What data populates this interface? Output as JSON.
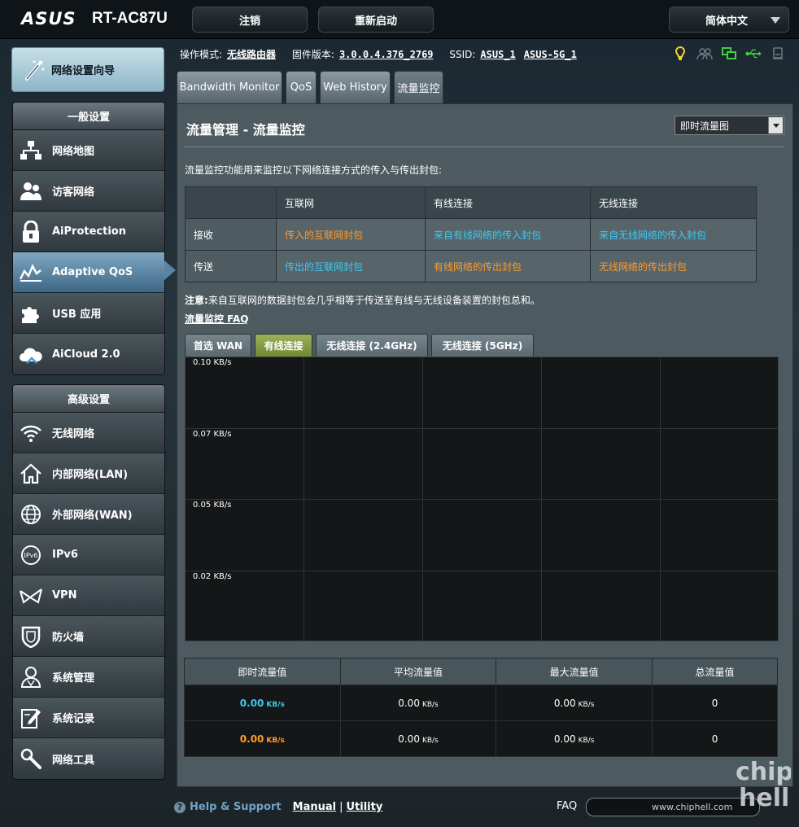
{
  "header": {
    "brand": "ASUS",
    "model": "RT-AC87U",
    "logout_label": "注销",
    "reboot_label": "重新启动",
    "language": "简体中文"
  },
  "sidebar": {
    "wizard_label": "网络设置向导",
    "general_title": "一般设置",
    "general_items": [
      {
        "label": "网络地图",
        "icon": "network-map-icon"
      },
      {
        "label": "访客网络",
        "icon": "guest-network-icon"
      },
      {
        "label": "AiProtection",
        "icon": "lock-icon"
      },
      {
        "label": "Adaptive QoS",
        "icon": "qos-icon",
        "active": true
      },
      {
        "label": "USB 应用",
        "icon": "puzzle-icon"
      },
      {
        "label": "AiCloud 2.0",
        "icon": "cloud-icon"
      }
    ],
    "advanced_title": "高级设置",
    "advanced_items": [
      {
        "label": "无线网络",
        "icon": "wifi-icon"
      },
      {
        "label": "内部网络(LAN)",
        "icon": "home-icon"
      },
      {
        "label": "外部网络(WAN)",
        "icon": "globe-icon"
      },
      {
        "label": "IPv6",
        "icon": "ipv6-icon"
      },
      {
        "label": "VPN",
        "icon": "vpn-icon"
      },
      {
        "label": "防火墙",
        "icon": "shield-icon"
      },
      {
        "label": "系统管理",
        "icon": "admin-icon"
      },
      {
        "label": "系统记录",
        "icon": "log-icon"
      },
      {
        "label": "网络工具",
        "icon": "tools-icon"
      }
    ]
  },
  "infobar": {
    "mode_key": "操作模式:",
    "mode_value": "无线路由器",
    "firmware_key": "固件版本:",
    "firmware_value": "3.0.0.4.376_2769",
    "ssid_key": "SSID:",
    "ssid_1": "ASUS_1",
    "ssid_2": "ASUS-5G_1"
  },
  "tabs": [
    {
      "label": "Bandwidth Monitor"
    },
    {
      "label": "QoS"
    },
    {
      "label": "Web History"
    },
    {
      "label": "流量监控",
      "active": true
    }
  ],
  "main": {
    "title": "流量管理 - 流量监控",
    "view_select": "即时流量图",
    "description": "流量监控功能用来监控以下网络连接方式的传入与传出封包:",
    "legend": {
      "headers": [
        "",
        "互联网",
        "有线连接",
        "无线连接"
      ],
      "rows": [
        {
          "label": "接收",
          "cells": [
            "传入的互联网封包",
            "来自有线网络的传入封包",
            "来自无线网络的传入封包"
          ]
        },
        {
          "label": "传送",
          "cells": [
            "传出的互联网封包",
            "有线网络的传出封包",
            "无线网络的传出封包"
          ]
        }
      ]
    },
    "note_bold": "注意:",
    "note_text": "来自互联网的数据封包会几乎相等于传送至有线与无线设备装置的封包总和。",
    "faq_link": "流量监控 FAQ",
    "subtabs": [
      "首选 WAN",
      "有线连接",
      "无线连接 (2.4GHz)",
      "无线连接 (5GHz)"
    ],
    "graph_labels": [
      "0.10 KB/s",
      "0.07 KB/s",
      "0.05 KB/s",
      "0.02 KB/s"
    ],
    "stats": {
      "headers": [
        "即时流量值",
        "平均流量值",
        "最大流量值",
        "总流量值"
      ],
      "rows": [
        {
          "current": "0.00",
          "avg": "0.00",
          "max": "0.00",
          "total": "0",
          "unit": "KB/s"
        },
        {
          "current": "0.00",
          "avg": "0.00",
          "max": "0.00",
          "total": "0",
          "unit": "KB/s"
        }
      ]
    }
  },
  "footer": {
    "help_support": "Help & Support",
    "manual": "Manual",
    "separator": "|",
    "utility": "Utility",
    "faq": "FAQ",
    "watermark_url": "www.chiphell.com"
  },
  "colors": {
    "orange": "#ff9a2b",
    "blue": "#3ec8f0",
    "accent": "#5a84a1"
  }
}
